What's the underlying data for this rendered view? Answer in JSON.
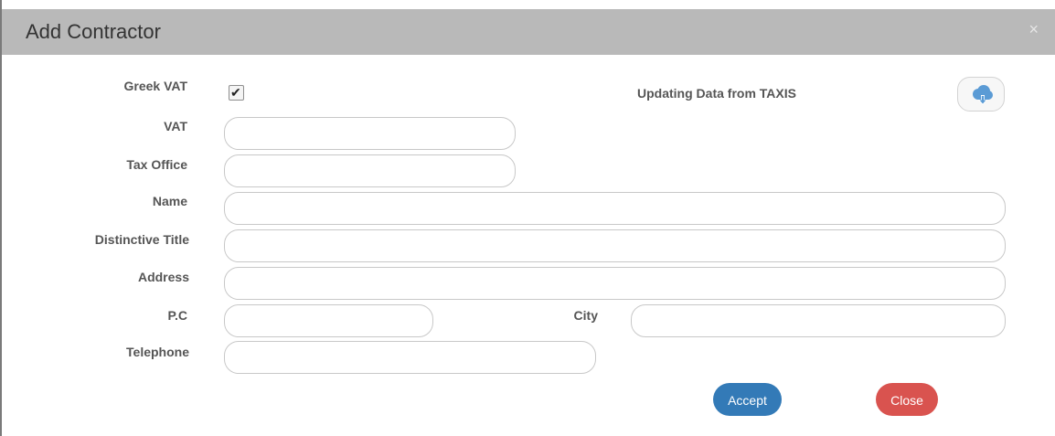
{
  "modal": {
    "title": "Add Contractor",
    "close_symbol": "×"
  },
  "form": {
    "greek_vat": {
      "label": "Greek VAT",
      "checked": true
    },
    "taxis": {
      "label": "Updating Data from TAXIS",
      "icon": "cloud-download-icon"
    },
    "vat": {
      "label": "VAT",
      "value": ""
    },
    "tax_office": {
      "label": "Tax Office",
      "value": ""
    },
    "name": {
      "label": "Name",
      "value": ""
    },
    "distinctive_title": {
      "label": "Distinctive Title",
      "value": ""
    },
    "address": {
      "label": "Address",
      "value": ""
    },
    "pc": {
      "label": "P.C",
      "value": ""
    },
    "city": {
      "label": "City",
      "value": ""
    },
    "telephone": {
      "label": "Telephone",
      "value": ""
    }
  },
  "buttons": {
    "accept": "Accept",
    "close": "Close"
  },
  "colors": {
    "header_bg": "#b9b9b9",
    "accept": "#337ab7",
    "close": "#d9534f",
    "icon": "#5b9bd5"
  }
}
